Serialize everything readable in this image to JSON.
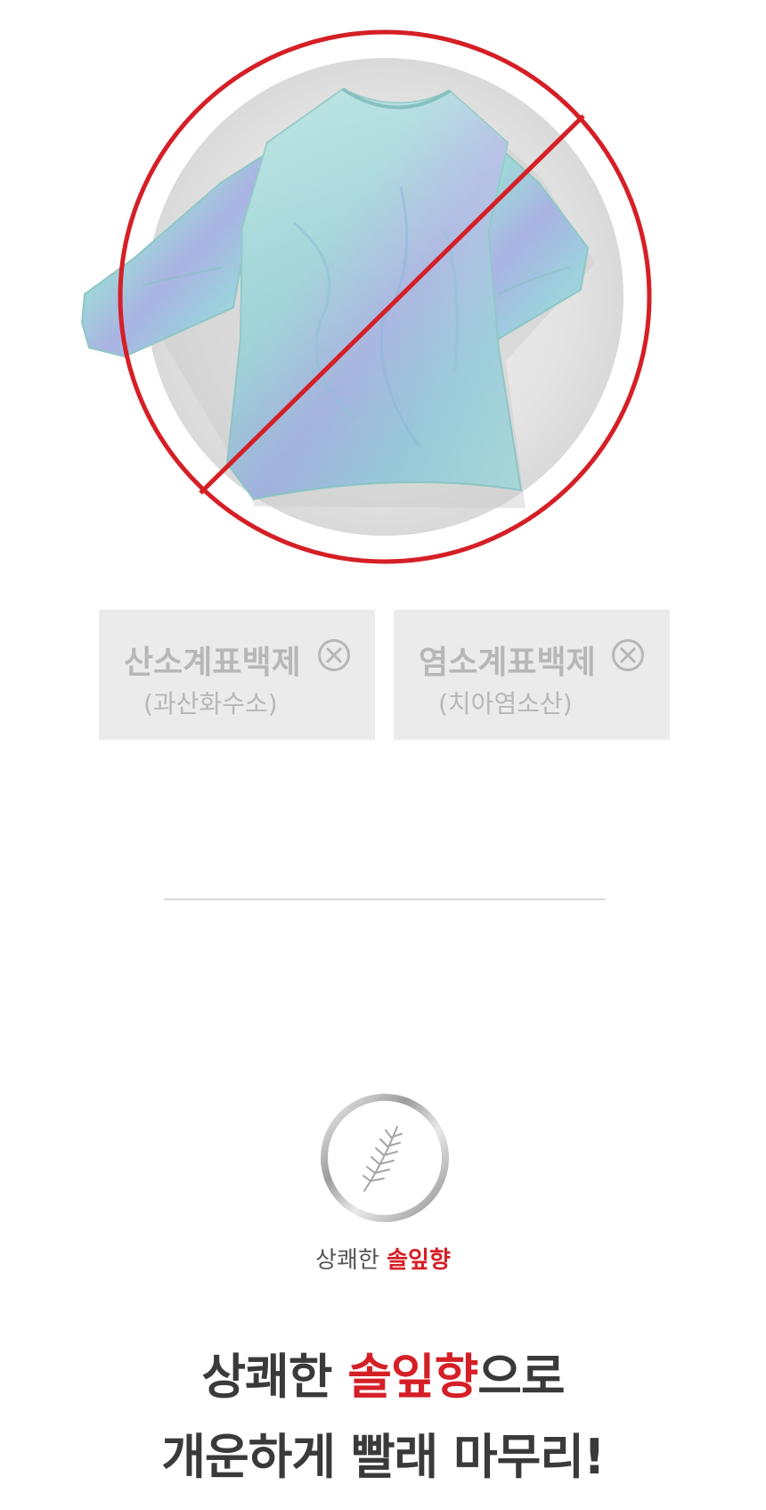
{
  "hero": {
    "image": "shirt-prohibited-illustration",
    "accent_color": "#d51f26"
  },
  "chemicals": [
    {
      "name": "산소계표백제",
      "detail": "(과산화수소)",
      "icon": "circle-x-icon"
    },
    {
      "name": "염소계표백제",
      "detail": "(치아염소산)",
      "icon": "circle-x-icon"
    }
  ],
  "scent": {
    "icon": "pine-leaf-icon",
    "label_prefix": "상쾌한 ",
    "label_accent": "솔잎향"
  },
  "headline": {
    "line1_prefix": "상쾌한 ",
    "line1_accent": "솔잎향",
    "line1_suffix": "으로",
    "line2": "개운하게 빨래 마무리!"
  },
  "colors": {
    "accent": "#d51f26",
    "box_bg": "#ebebeb",
    "muted_text": "#b7b7b7",
    "dark_text": "#3a3a3a"
  }
}
